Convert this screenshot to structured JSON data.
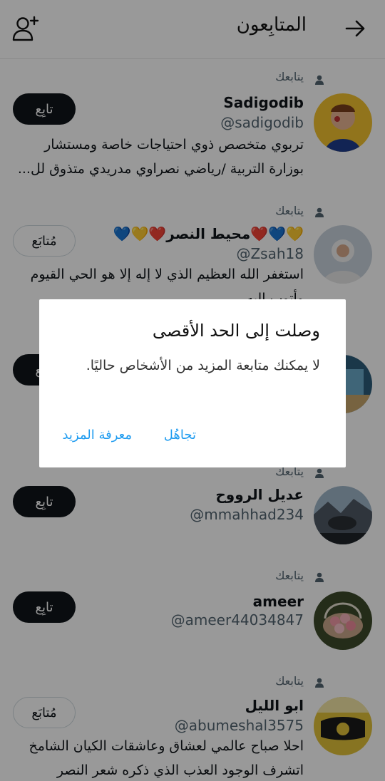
{
  "header": {
    "title": "المتابِعون"
  },
  "users": [
    {
      "follows_you": "يتابعك",
      "name": "Sadigodib",
      "handle": "@sadigodib",
      "bio": "تربوي متخصص ذوي احتياجات خاصة ومستشار بوزارة التربية /رياضي نصراوي مدريدي متذوق لل...",
      "button": "تابِع",
      "button_state": "follow"
    },
    {
      "follows_you": "يتابعك",
      "name": "💛💙❤️محيط النصر❤️💛💙",
      "handle": "@Zsah18",
      "bio": "استغفر الله العظيم الذي لا إله إلا هو الحي القيوم وأتوب إليه",
      "button": "مُتابَع",
      "button_state": "following"
    },
    {
      "button": "تابِع",
      "button_state": "follow"
    },
    {
      "follows_you": "يتابعك",
      "name": "عديل الرووح",
      "handle": "@mmahhad234",
      "button": "تابِع",
      "button_state": "follow"
    },
    {
      "follows_you": "يتابعك",
      "name": "ameer",
      "handle": "@ameer44034847",
      "button": "تابِع",
      "button_state": "follow"
    },
    {
      "follows_you": "يتابعك",
      "name": "ابو الليل",
      "handle": "@abumeshal3575",
      "bio": "احلا صباح عالمي لعشاق وعاشقات الكيان الشامخ اتشرف الوجود العذب الذي ذكره شعر النصر",
      "button": "مُتابَع",
      "button_state": "following"
    }
  ],
  "dialog": {
    "title": "وصلت إلى الحد الأقصى",
    "body": "لا يمكنك متابعة المزيد من الأشخاص حاليًا.",
    "ignore": "تجاهُل",
    "learn_more": "معرفة المزيد"
  }
}
